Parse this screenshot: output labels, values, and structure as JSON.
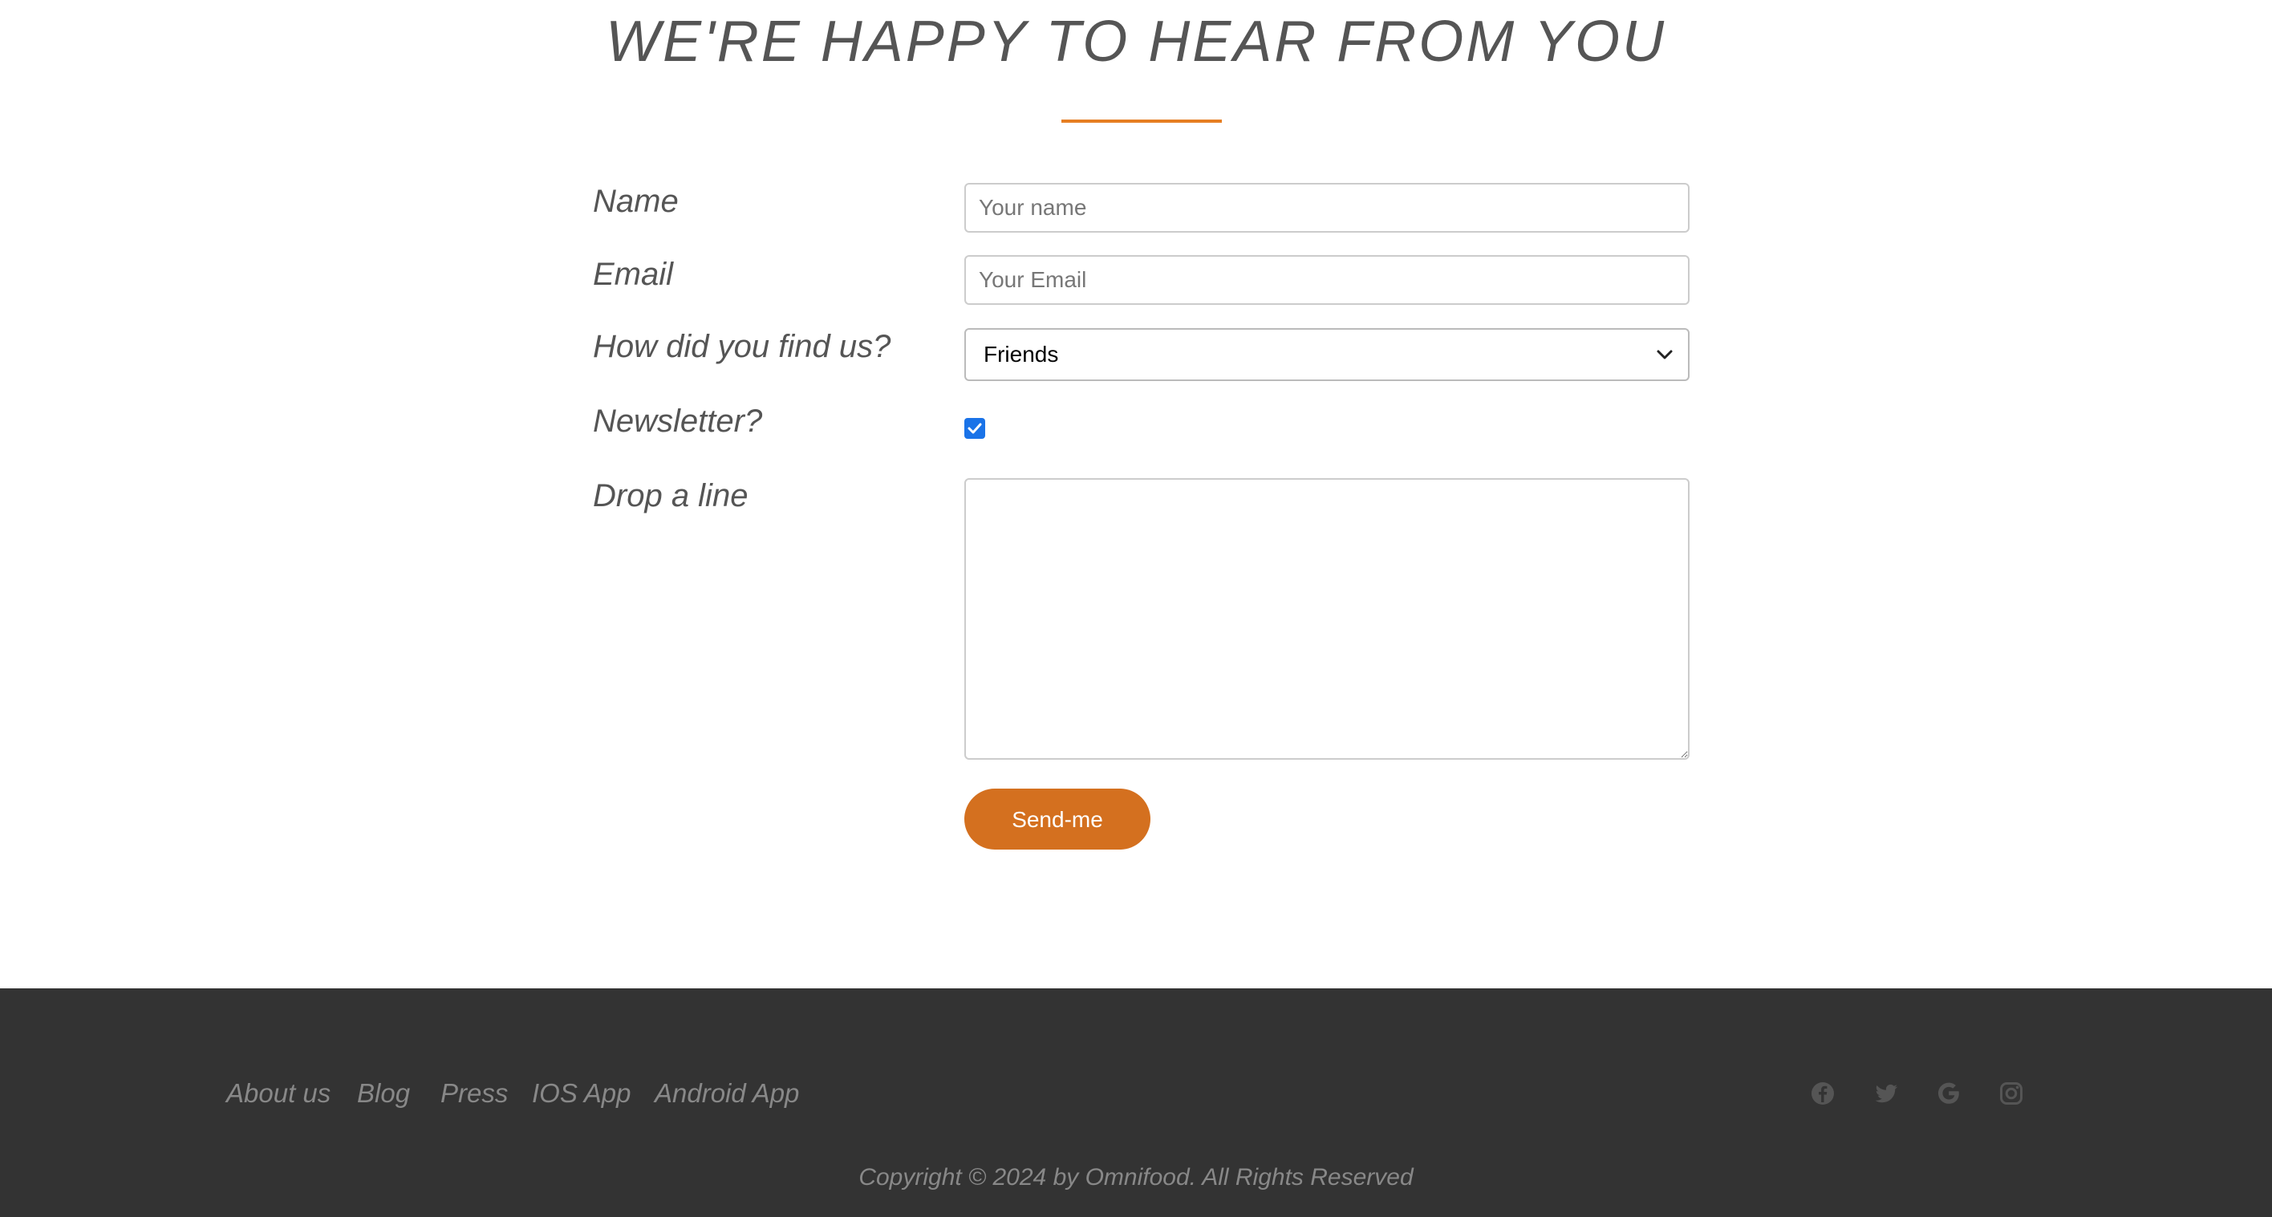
{
  "contact": {
    "heading": "WE'RE HAPPY TO HEAR FROM YOU",
    "accent_color": "#e67e22",
    "form": {
      "name_label": "Name",
      "name_placeholder": "Your name",
      "email_label": "Email",
      "email_placeholder": "Your Email",
      "find_label": "How did you find us?",
      "find_selected": "Friends",
      "newsletter_label": "Newsletter?",
      "newsletter_checked": true,
      "message_label": "Drop a line",
      "message_value": "",
      "submit_label": "Send-me",
      "submit_color": "#d4701f"
    }
  },
  "footer": {
    "background": "#333333",
    "nav": [
      {
        "label": "About us"
      },
      {
        "label": "Blog"
      },
      {
        "label": "Press"
      },
      {
        "label": "IOS App"
      },
      {
        "label": "Android App"
      }
    ],
    "social_icons": [
      "facebook-icon",
      "twitter-icon",
      "google-icon",
      "instagram-icon"
    ],
    "copyright": "Copyright © 2024 by Omnifood. All Rights Reserved"
  }
}
